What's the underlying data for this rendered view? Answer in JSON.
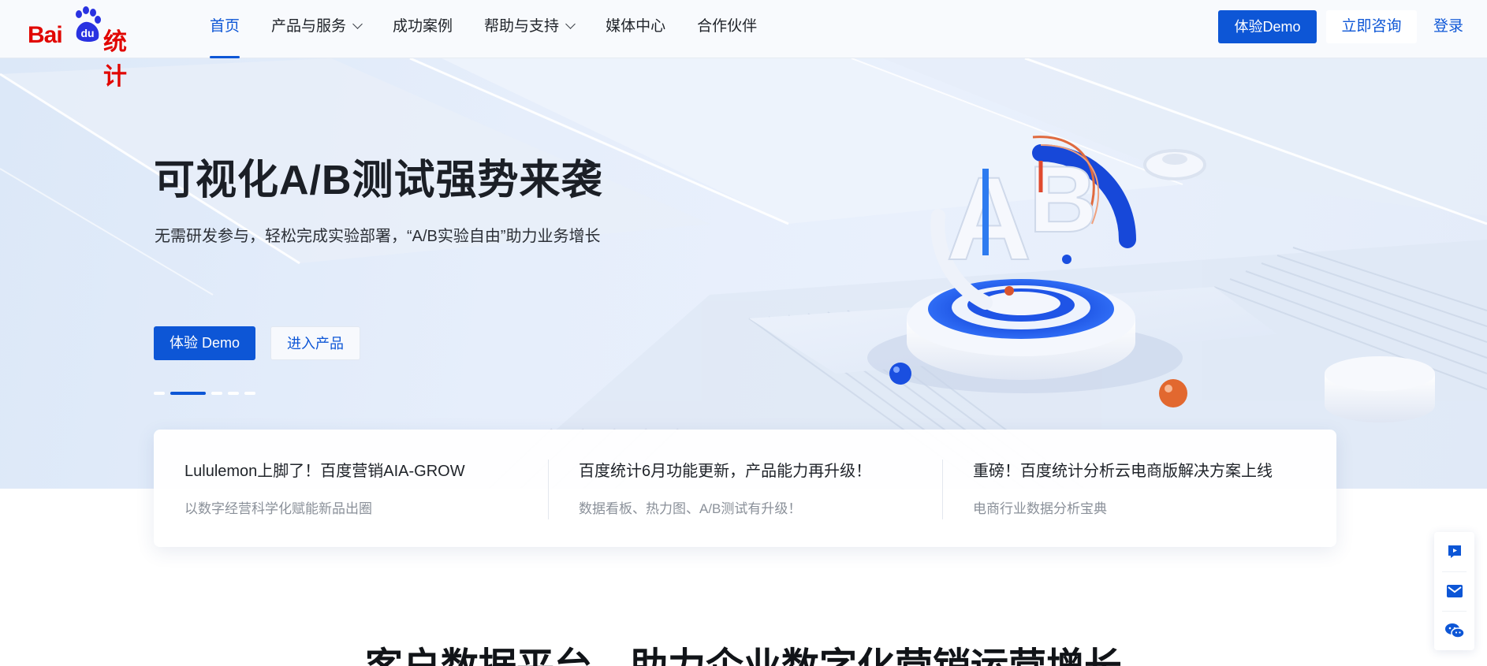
{
  "brand": {
    "logo_left": "Bai",
    "logo_mid": "du",
    "logo_right": "统计",
    "red": "#e10601",
    "blue": "#0d56d6"
  },
  "nav": {
    "items": [
      {
        "label": "首页",
        "active": true
      },
      {
        "label": "产品与服务",
        "dropdown": true
      },
      {
        "label": "成功案例"
      },
      {
        "label": "帮助与支持",
        "dropdown": true
      },
      {
        "label": "媒体中心"
      },
      {
        "label": "合作伙伴"
      }
    ],
    "demo_label": "体验Demo",
    "consult_label": "立即咨询",
    "login_label": "登录"
  },
  "hero": {
    "title": "可视化A/B测试强势来袭",
    "subtitle": "无需研发参与，轻松完成实验部署，“A/B实验自由”助力业务增长",
    "primary_button": "体验 Demo",
    "secondary_button": "进入产品",
    "art_letters": [
      "A",
      "B"
    ],
    "slide_count": 5,
    "active_slide": 1
  },
  "news": [
    {
      "title": "Lululemon上脚了！百度营销AIA-GROW",
      "desc": "以数字经营科学化赋能新品出圈"
    },
    {
      "title": "百度统计6月功能更新，产品能力再升级！",
      "desc": "数据看板、热力图、A/B测试有升级！"
    },
    {
      "title": "重磅！百度统计分析云电商版解决方案上线",
      "desc": "电商行业数据分析宝典"
    }
  ],
  "float_bar": {
    "icons": [
      "video-icon",
      "mail-icon",
      "wechat-icon"
    ]
  },
  "section": {
    "title": "客户数据平台，助力企业数字化营销运营增长"
  }
}
